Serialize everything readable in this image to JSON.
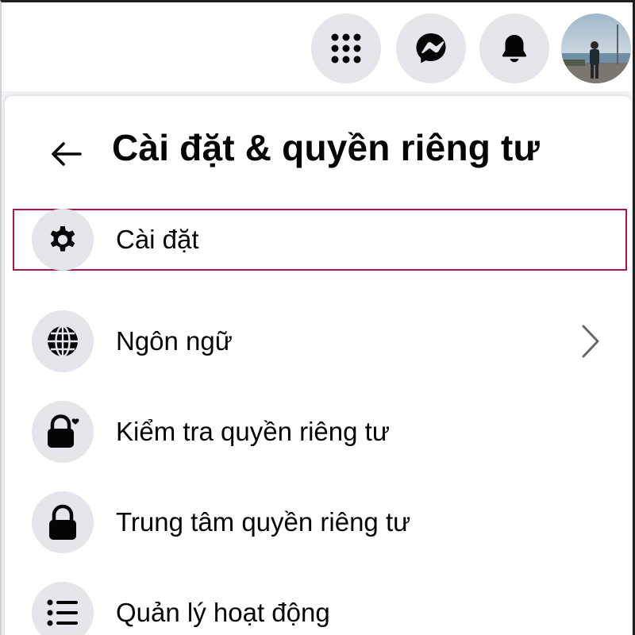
{
  "topbar": {
    "icons": [
      "menu-grid-icon",
      "messenger-icon",
      "bell-icon"
    ],
    "avatar_alt": "profile-photo"
  },
  "panel": {
    "title": "Cài đặt & quyền riêng tư",
    "items": [
      {
        "label": "Cài đặt",
        "icon": "gear-icon",
        "highlighted": true
      },
      {
        "label": "Ngôn ngữ",
        "icon": "globe-icon",
        "has_chevron": true
      },
      {
        "label": "Kiểm tra quyền riêng tư",
        "icon": "lock-heart-icon"
      },
      {
        "label": "Trung tâm quyền riêng tư",
        "icon": "lock-icon"
      },
      {
        "label": "Quản lý hoạt động",
        "icon": "list-icon"
      }
    ]
  },
  "colors": {
    "page_bg": "#f0f2f5",
    "icon_circle": "#e4e6eb",
    "text": "#050505",
    "highlight_border": "#b0144e"
  }
}
